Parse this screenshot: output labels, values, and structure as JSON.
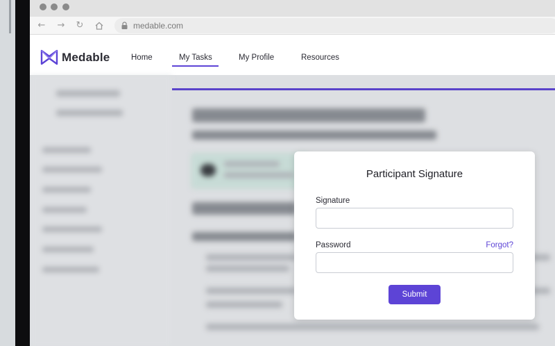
{
  "browser": {
    "url": "medable.com",
    "icons": [
      "back-arrow-icon",
      "forward-arrow-icon",
      "reload-icon",
      "home-icon",
      "lock-icon"
    ]
  },
  "header": {
    "logo_text": "Medable",
    "nav": [
      {
        "label": "Home"
      },
      {
        "label": "My Tasks",
        "active": true
      },
      {
        "label": "My Profile"
      },
      {
        "label": "Resources"
      }
    ]
  },
  "modal": {
    "title": "Participant Signature",
    "signature_label": "Signature",
    "signature_value": "",
    "password_label": "Password",
    "password_value": "",
    "forgot_label": "Forgot?",
    "submit_label": "Submit"
  },
  "colors": {
    "accent": "#5d44d6",
    "bezel_black": "#0d0d0f",
    "callout_green": "#d3e9e3"
  }
}
